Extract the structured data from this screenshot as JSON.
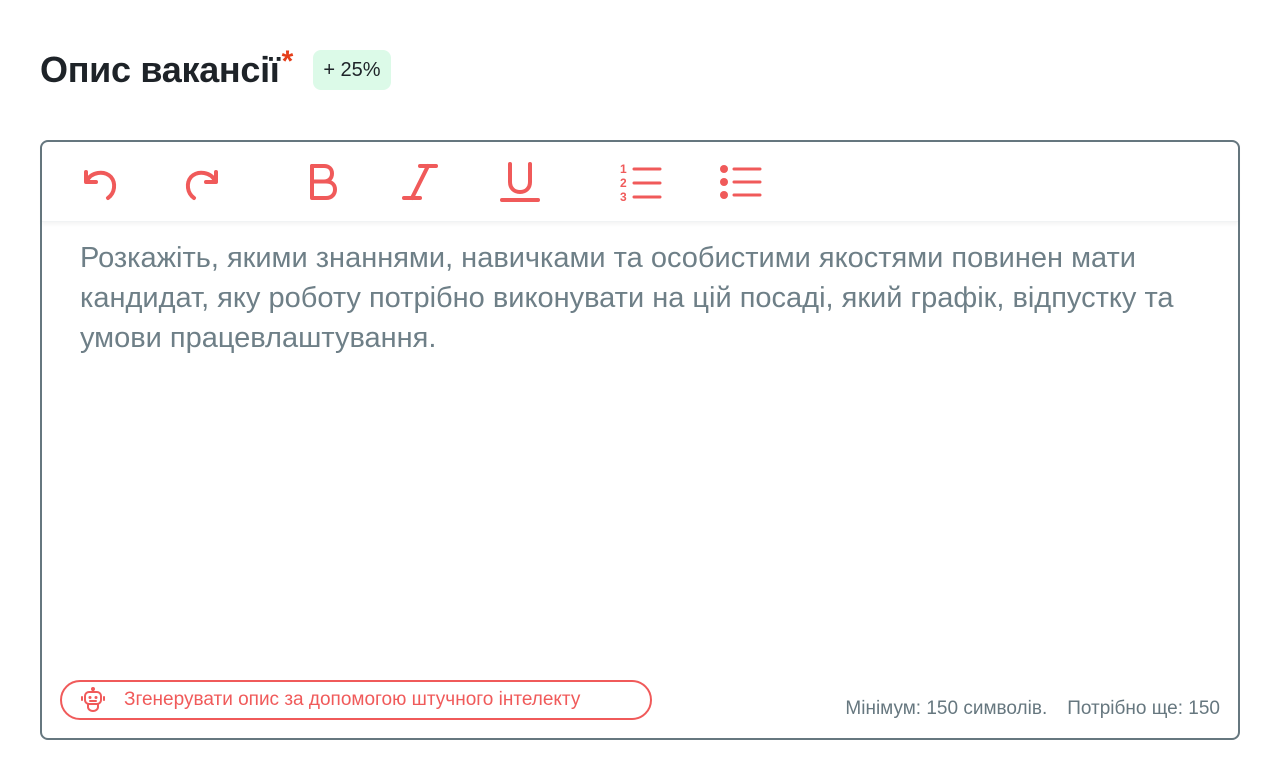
{
  "header": {
    "title": "Опис вакансії",
    "required_mark": "*",
    "badge": "+ 25%"
  },
  "editor": {
    "placeholder": "Розкажіть, якими знаннями, навичками та особистими якостями повинен мати кандидат, яку роботу потрібно виконувати на цій посаді, який графік, відпустку та умови працевлаштування.",
    "toolbar": [
      "undo-icon",
      "redo-icon",
      "bold-icon",
      "italic-icon",
      "underline-icon",
      "ordered-list-icon",
      "bullet-list-icon"
    ],
    "ai_button_label": "Згенерувати опис за допомогою штучного інтелекту",
    "minimum_text": "Мінімум: 150 символів.",
    "remaining_text": "Потрібно ще: 150"
  },
  "colors": {
    "accent": "#f05a5a",
    "required": "#e53e1a",
    "badge_bg": "#dcfae8",
    "border": "#66777f",
    "placeholder": "#6e7f87"
  }
}
